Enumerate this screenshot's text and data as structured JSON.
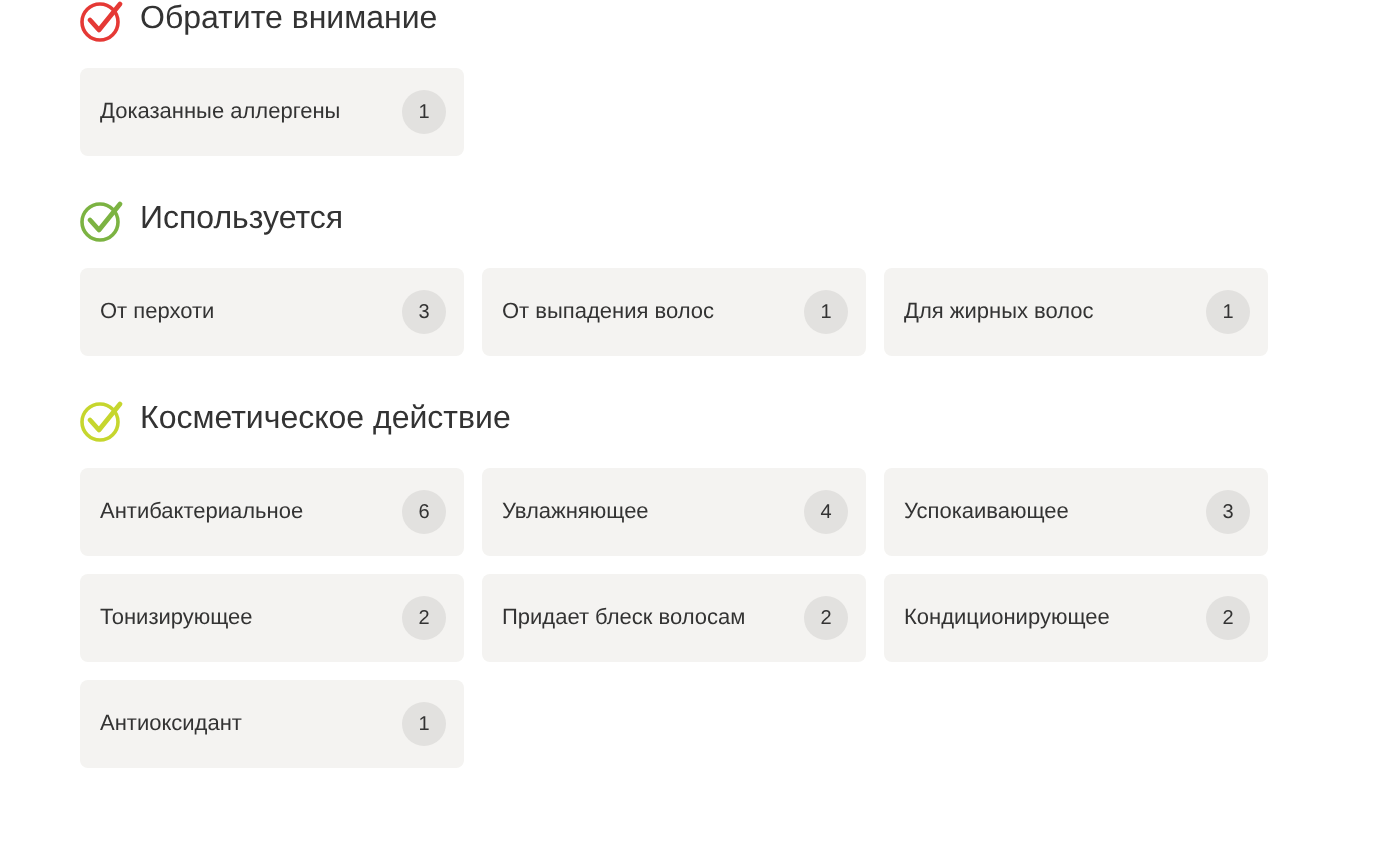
{
  "sections": [
    {
      "title": "Обратите внимание",
      "color": "#e53935",
      "items": [
        {
          "label": "Доказанные аллергены",
          "count": "1"
        }
      ]
    },
    {
      "title": "Используется",
      "color": "#7cb342",
      "items": [
        {
          "label": "От перхоти",
          "count": "3"
        },
        {
          "label": "От выпадения волос",
          "count": "1"
        },
        {
          "label": "Для жирных волос",
          "count": "1"
        }
      ]
    },
    {
      "title": "Косметическое действие",
      "color": "#c6d62e",
      "items": [
        {
          "label": "Антибактериальное",
          "count": "6"
        },
        {
          "label": "Увлажняющее",
          "count": "4"
        },
        {
          "label": "Успокаивающее",
          "count": "3"
        },
        {
          "label": "Тонизирующее",
          "count": "2"
        },
        {
          "label": "Придает блеск волосам",
          "count": "2"
        },
        {
          "label": "Кондиционирующее",
          "count": "2"
        },
        {
          "label": "Антиоксидант",
          "count": "1"
        }
      ]
    }
  ]
}
